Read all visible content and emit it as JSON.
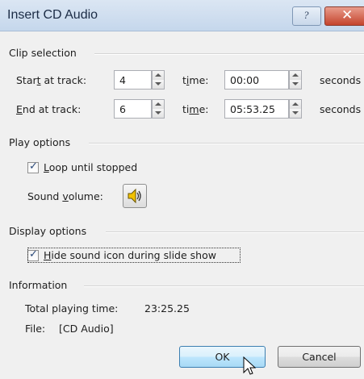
{
  "dialog": {
    "title": "Insert CD Audio",
    "help_glyph": "?",
    "close_glyph": "✕"
  },
  "clip_selection": {
    "heading": "Clip selection",
    "start_label_pre": "Star",
    "start_label_u": "t",
    "start_label_post": " at track:",
    "start_track": "4",
    "start_time_label_pre": "t",
    "start_time_label_u": "i",
    "start_time_label_post": "me:",
    "start_time": "00:00",
    "start_unit": "seconds",
    "end_label_pre": "",
    "end_label_u": "E",
    "end_label_post": "nd at track:",
    "end_track": "6",
    "end_time_label_pre": "ti",
    "end_time_label_u": "m",
    "end_time_label_post": "e:",
    "end_time": "05:53.25",
    "end_unit": "seconds"
  },
  "play_options": {
    "heading": "Play options",
    "loop_u": "L",
    "loop_rest": "oop until stopped",
    "loop_checked": true,
    "volume_pre": "Sound ",
    "volume_u": "v",
    "volume_post": "olume:"
  },
  "display_options": {
    "heading": "Display options",
    "hide_u": "H",
    "hide_rest": "ide sound icon during slide show",
    "hide_checked": true
  },
  "information": {
    "heading": "Information",
    "total_label": "Total playing time:",
    "total_value": "23:25.25",
    "file_label": "File:",
    "file_value": "[CD Audio]"
  },
  "buttons": {
    "ok": "OK",
    "cancel": "Cancel"
  },
  "icons": {
    "help": "question-mark-icon",
    "close": "close-icon",
    "volume": "speaker-icon",
    "check": "checkmark-icon",
    "cursor": "mouse-pointer-icon"
  }
}
